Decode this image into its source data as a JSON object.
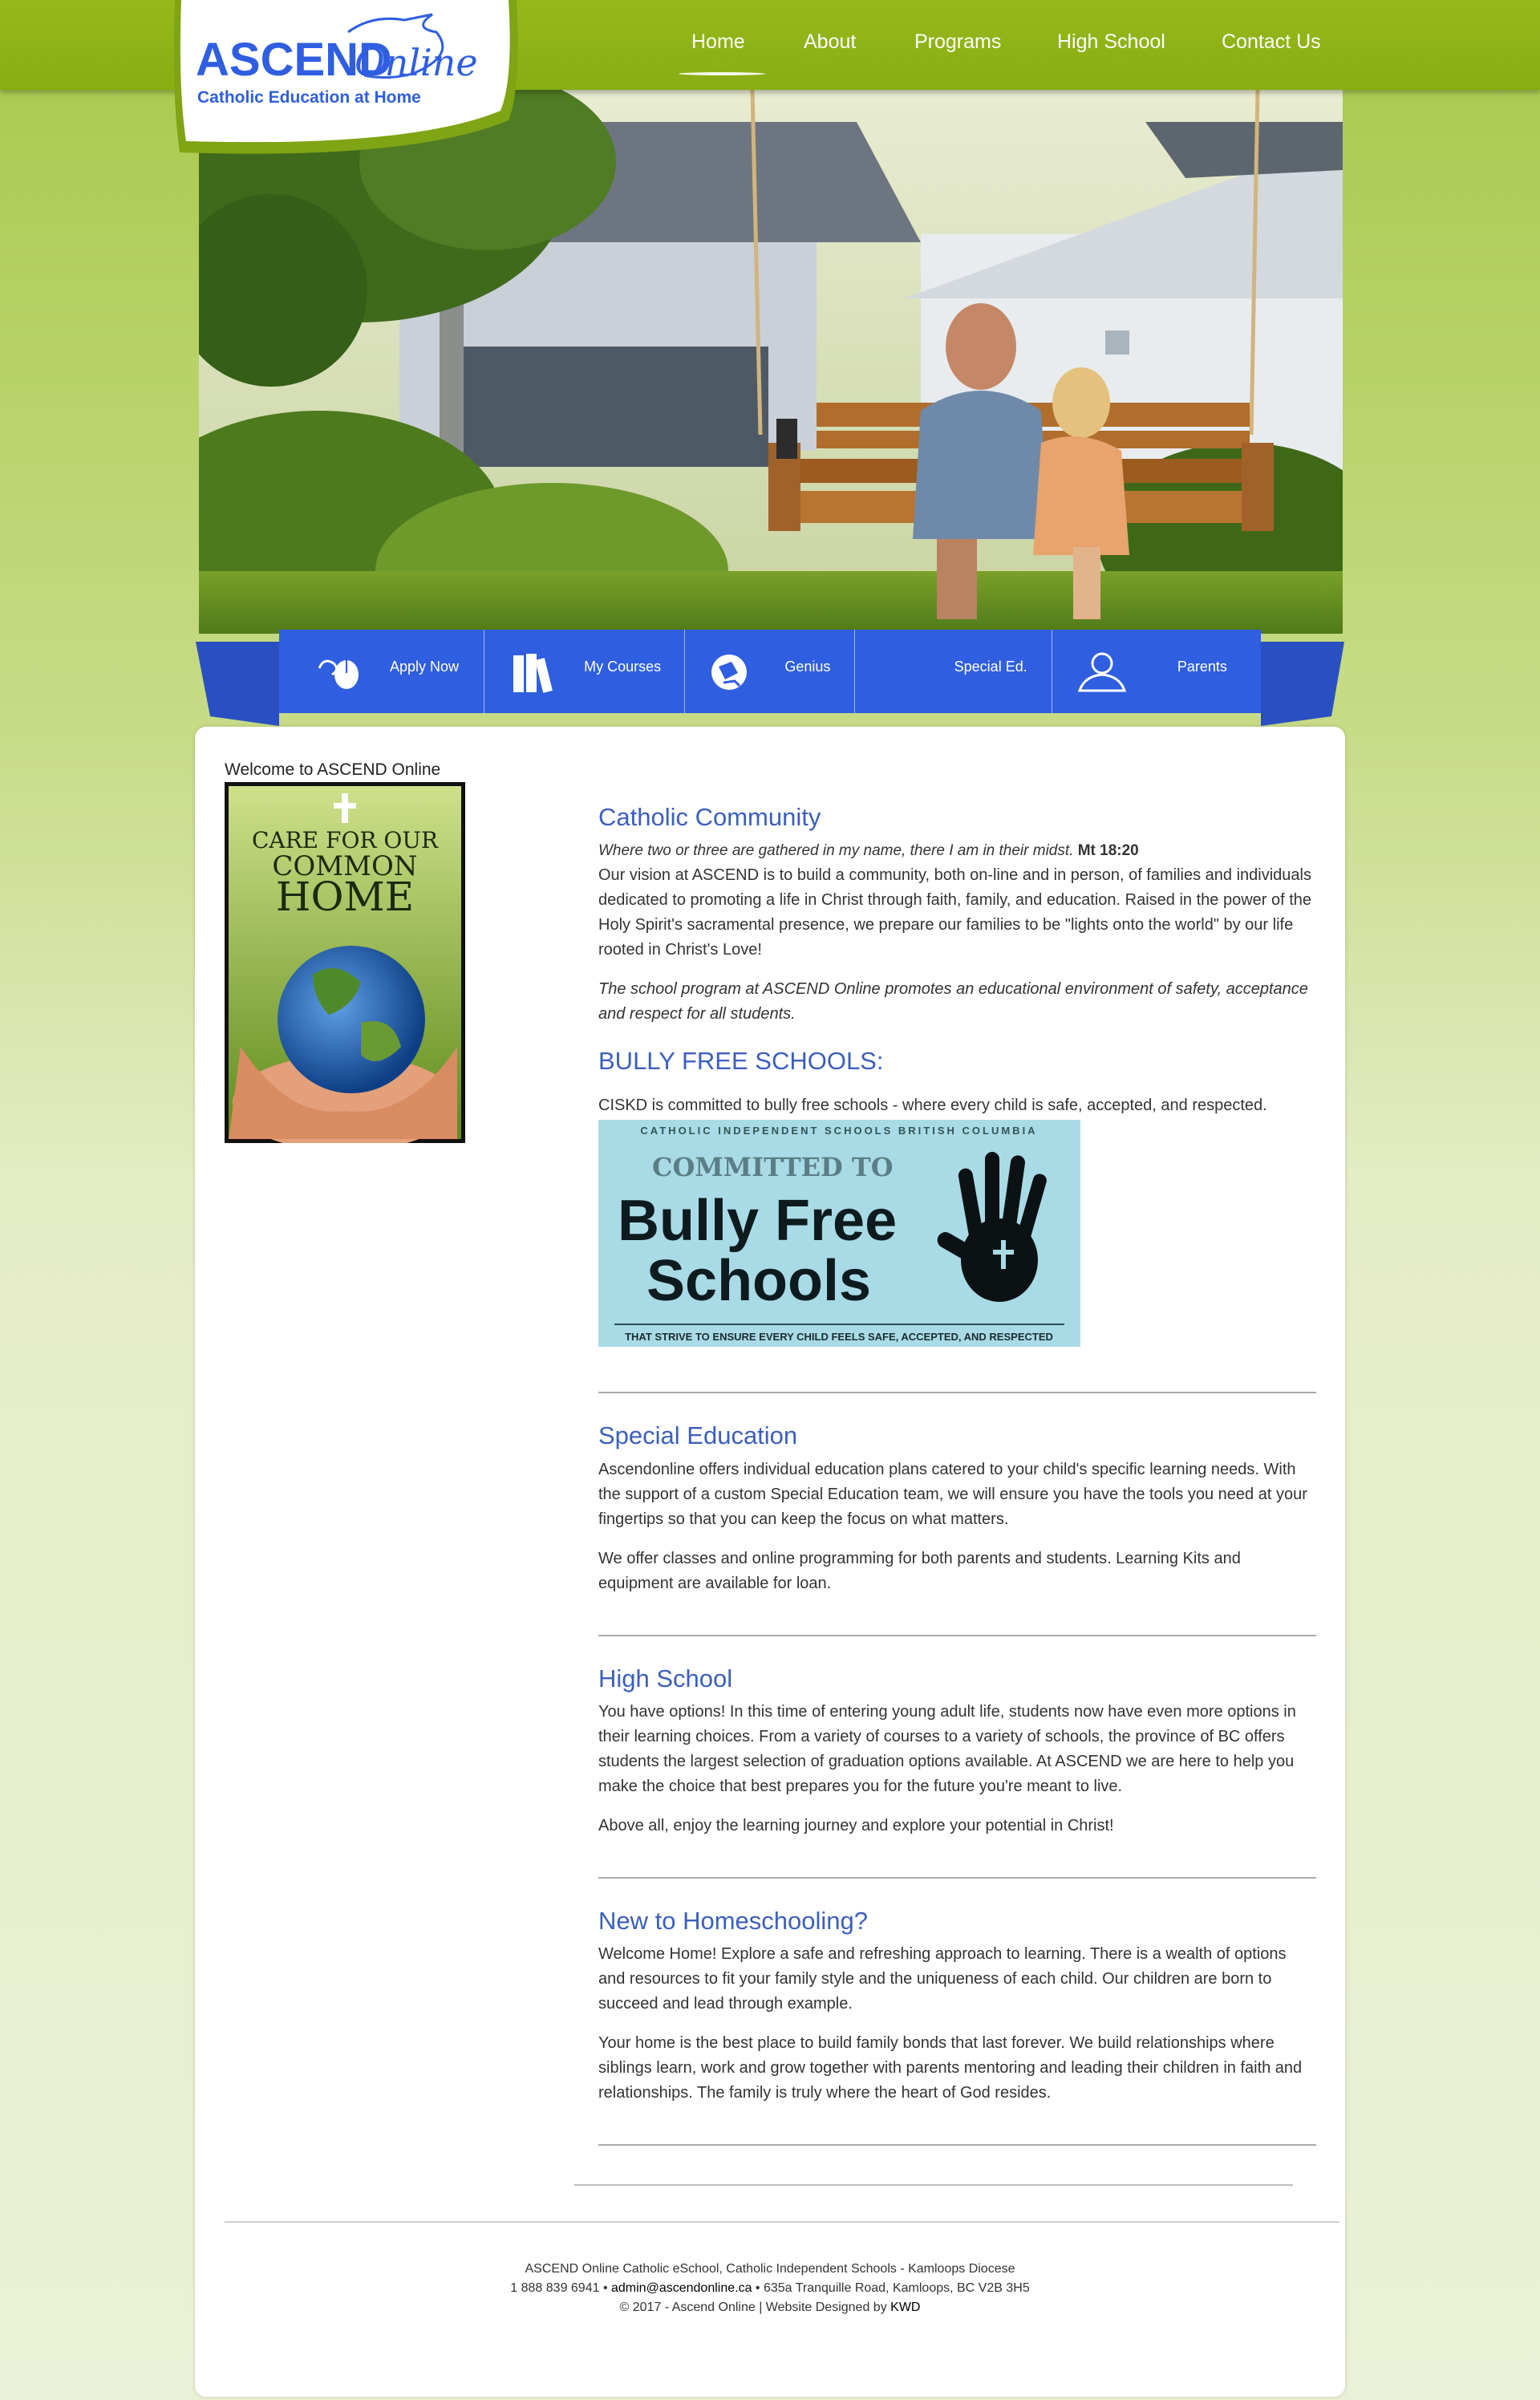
{
  "logo": {
    "brand_main": "ASCEND",
    "brand_script": "Online",
    "tagline": "Catholic Education at Home"
  },
  "nav": {
    "items": [
      "Home",
      "About",
      "Programs",
      "High School",
      "Contact Us"
    ]
  },
  "quick_links": [
    "Apply Now",
    "My Courses",
    "Genius",
    "Special Ed.",
    "Parents"
  ],
  "sidebar": {
    "welcome": "Welcome to ASCEND Online",
    "poster": {
      "line1": "CARE FOR OUR",
      "line2": "COMMON",
      "line3": "HOME"
    }
  },
  "community": {
    "heading": "Catholic Community",
    "quote": "Where two or three are gathered in my name, there I am in their midst.",
    "quote_ref": "Mt 18:20",
    "para1": "Our vision at ASCEND is to build a community, both on-line and in person, of families and individuals dedicated to promoting a life in Christ through faith, family, and education.  Raised in the power of the Holy Spirit's sacramental presence, we prepare our families to be \"lights onto the world\" by our life rooted in Christ's Love!",
    "para2": "The school program at ASCEND Online promotes an educational environment of safety, acceptance and respect for all students."
  },
  "bully": {
    "heading": "BULLY FREE SCHOOLS:",
    "text": "CISKD is committed to bully free schools - where every child is safe, accepted, and respected.",
    "banner": {
      "top": "CATHOLIC INDEPENDENT SCHOOLS BRITISH COLUMBIA",
      "committed": "COMMITTED TO",
      "line1": "Bully Free",
      "line2": "Schools",
      "bottom": "THAT STRIVE TO ENSURE EVERY CHILD FEELS SAFE, ACCEPTED, AND RESPECTED"
    }
  },
  "special": {
    "heading": "Special Education",
    "para1": "Ascendonline offers individual education plans catered to your child's specific learning needs. With the support of a custom Special Education team, we will ensure you have the tools you need at your fingertips so that you can keep the focus on what matters.",
    "para2": "We offer classes and online programming for both parents and students. Learning Kits and equipment are available for loan."
  },
  "highschool": {
    "heading": "High School",
    "para1": "You have options! In this time of entering young adult life, students now have even more options in their learning choices. From a variety of courses to a variety of schools, the province of BC offers students the largest selection of graduation options available. At ASCEND we are here to help you make the choice that best prepares you for the future you're meant to live.",
    "para2": "Above all, enjoy the learning journey and explore your potential in Christ!"
  },
  "homeschool": {
    "heading": "New to Homeschooling?",
    "para1": "Welcome Home! Explore a safe and refreshing approach to learning. There is a wealth of options and resources to fit your family style and the uniqueness of each child. Our children are born to succeed and lead through example.",
    "para2": "Your home is the best place to build family bonds that last forever. We build relationships where siblings learn, work and grow together with parents mentoring and leading their children in faith and relationships. The family is truly where the heart of God resides."
  },
  "footer": {
    "line1": "ASCEND Online Catholic eSchool, Catholic Independent Schools - Kamloops Diocese",
    "phone": "1 888 839 6941",
    "sep1": " • ",
    "email": "admin@ascendonline.ca",
    "address": " • 635a Tranquille Road, Kamloops, BC V2B 3H5",
    "copyright": "© 2017 - Ascend Online | Website Designed by ",
    "designer": "KWD"
  },
  "colors": {
    "green": "#8fb317",
    "blue": "#2f5ee0",
    "heading_blue": "#3c5fbd"
  }
}
